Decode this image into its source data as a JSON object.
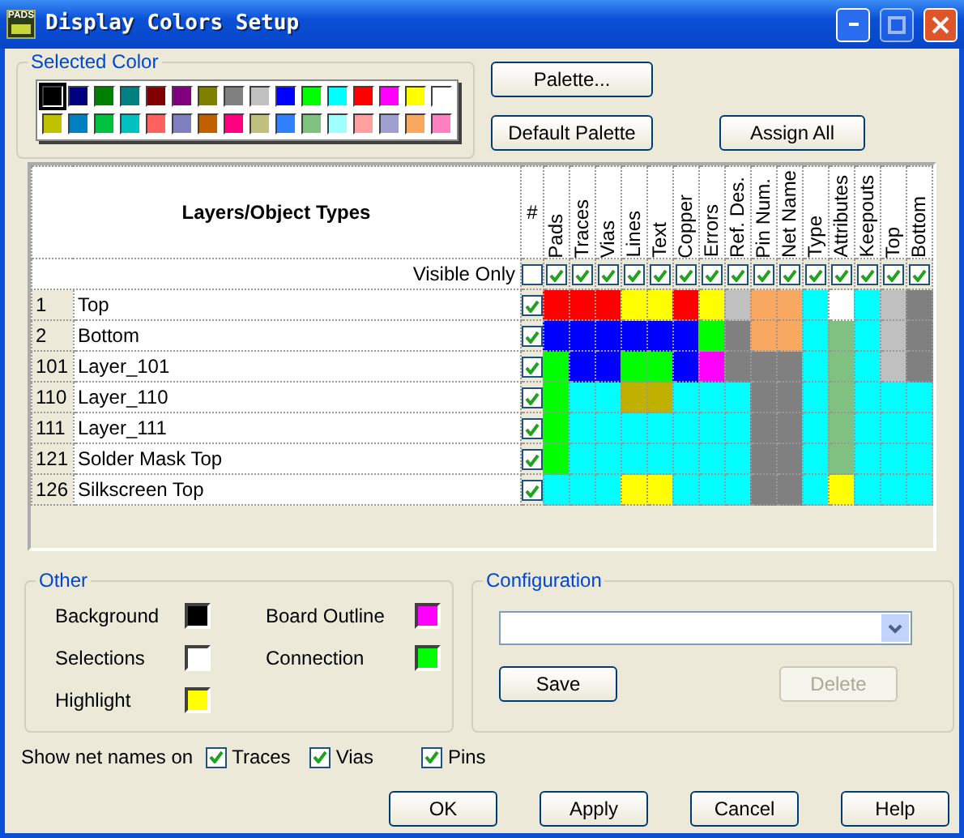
{
  "window": {
    "icon_text": "PADS",
    "title": "Display Colors Setup"
  },
  "selected_color": {
    "title": "Selected Color",
    "swatches": [
      {
        "color": "#000000",
        "selected": true
      },
      {
        "color": "#000080",
        "selected": false
      },
      {
        "color": "#008000",
        "selected": false
      },
      {
        "color": "#008080",
        "selected": false
      },
      {
        "color": "#800000",
        "selected": false
      },
      {
        "color": "#800080",
        "selected": false
      },
      {
        "color": "#808000",
        "selected": false
      },
      {
        "color": "#808080",
        "selected": false
      },
      {
        "color": "#c0c0c0",
        "selected": false
      },
      {
        "color": "#0000ff",
        "selected": false
      },
      {
        "color": "#00ff00",
        "selected": false
      },
      {
        "color": "#00ffff",
        "selected": false
      },
      {
        "color": "#ff0000",
        "selected": false
      },
      {
        "color": "#ff00ff",
        "selected": false
      },
      {
        "color": "#ffff00",
        "selected": false
      },
      {
        "color": "#ffffff",
        "selected": false
      },
      {
        "color": "#c0c000",
        "selected": false
      },
      {
        "color": "#0080c0",
        "selected": false
      },
      {
        "color": "#00c040",
        "selected": false
      },
      {
        "color": "#00c0c0",
        "selected": false
      },
      {
        "color": "#ff6060",
        "selected": false
      },
      {
        "color": "#8080c0",
        "selected": false
      },
      {
        "color": "#c06000",
        "selected": false
      },
      {
        "color": "#ff0080",
        "selected": false
      },
      {
        "color": "#c0c080",
        "selected": false
      },
      {
        "color": "#3080ff",
        "selected": false
      },
      {
        "color": "#80c080",
        "selected": false
      },
      {
        "color": "#a0ffff",
        "selected": false
      },
      {
        "color": "#ffa0a0",
        "selected": false
      },
      {
        "color": "#a0a0d0",
        "selected": false
      },
      {
        "color": "#f8a860",
        "selected": false
      },
      {
        "color": "#ff80c0",
        "selected": false
      }
    ]
  },
  "palette_buttons": [
    {
      "label": "Palette..."
    },
    {
      "label": "Default Palette"
    },
    {
      "label": "Assign All"
    }
  ],
  "grid": {
    "title": "Layers/Object Types",
    "hash_header": "#",
    "visible_only": {
      "label": "Visible Only",
      "checked": false
    },
    "columns": [
      {
        "label": "Pads",
        "visible": true
      },
      {
        "label": "Traces",
        "visible": true
      },
      {
        "label": "Vias",
        "visible": true
      },
      {
        "label": "Lines",
        "visible": true
      },
      {
        "label": "Text",
        "visible": true
      },
      {
        "label": "Copper",
        "visible": true
      },
      {
        "label": "Errors",
        "visible": true
      },
      {
        "label": "Ref. Des.",
        "visible": true
      },
      {
        "label": "Pin Num.",
        "visible": true
      },
      {
        "label": "Net Name",
        "visible": true
      },
      {
        "label": "Type",
        "visible": true
      },
      {
        "label": "Attributes",
        "visible": true
      },
      {
        "label": "Keepouts",
        "visible": true
      },
      {
        "label": "Top",
        "visible": true
      },
      {
        "label": "Bottom",
        "visible": true
      }
    ],
    "rows": [
      {
        "number": "1",
        "name": "Top",
        "visible": true,
        "cells": [
          {
            "color": "#ff0000"
          },
          {
            "color": "#ff0000"
          },
          {
            "color": "#ff0000"
          },
          {
            "color": "#ffff00"
          },
          {
            "color": "#ffff00"
          },
          {
            "color": "#ff0000"
          },
          {
            "color": "#ffff00"
          },
          {
            "color": "#c0c0c0"
          },
          {
            "color": "#f8a860"
          },
          {
            "color": "#f8a860"
          },
          {
            "color": "#00ffff"
          },
          {
            "color": "#ffffff"
          },
          {
            "color": "#00ffff"
          },
          {
            "color": "#c0c0c0"
          },
          {
            "color": "#808080"
          }
        ]
      },
      {
        "number": "2",
        "name": "Bottom",
        "visible": true,
        "cells": [
          {
            "color": "#0000ff"
          },
          {
            "color": "#0000ff"
          },
          {
            "color": "#0000ff"
          },
          {
            "color": "#0000ff"
          },
          {
            "color": "#0000ff"
          },
          {
            "color": "#0000ff"
          },
          {
            "color": "#00ff00"
          },
          {
            "color": "#808080"
          },
          {
            "color": "#f8a860"
          },
          {
            "color": "#f8a860"
          },
          {
            "color": "#00ffff"
          },
          {
            "color": "#80c080"
          },
          {
            "color": "#00ffff"
          },
          {
            "color": "#c0c0c0"
          },
          {
            "color": "#808080"
          }
        ]
      },
      {
        "number": "101",
        "name": "Layer_101",
        "visible": true,
        "cells": [
          {
            "color": "#00ff00"
          },
          {
            "color": "#0000ff"
          },
          {
            "color": "#0000ff"
          },
          {
            "color": "#00ff00"
          },
          {
            "color": "#00ff00"
          },
          {
            "color": "#0000ff"
          },
          {
            "color": "#ff00ff"
          },
          {
            "color": "#808080"
          },
          {
            "color": "#808080"
          },
          {
            "color": "#808080"
          },
          {
            "color": "#00ffff"
          },
          {
            "color": "#80c080"
          },
          {
            "color": "#00ffff"
          },
          {
            "color": "#c0c0c0"
          },
          {
            "color": "#808080"
          }
        ]
      },
      {
        "number": "110",
        "name": "Layer_110",
        "visible": true,
        "cells": [
          {
            "color": "#00ff00"
          },
          {
            "color": "#00ffff"
          },
          {
            "color": "#00ffff"
          },
          {
            "color": "#c0b000"
          },
          {
            "color": "#c0b000"
          },
          {
            "color": "#00ffff"
          },
          {
            "color": "#00ffff"
          },
          {
            "color": "#00ffff"
          },
          {
            "color": "#808080"
          },
          {
            "color": "#808080"
          },
          {
            "color": "#00ffff"
          },
          {
            "color": "#80c080"
          },
          {
            "color": "#00ffff"
          },
          {
            "color": "#00ffff"
          },
          {
            "color": "#00ffff"
          }
        ]
      },
      {
        "number": "111",
        "name": "Layer_111",
        "visible": true,
        "cells": [
          {
            "color": "#00ff00"
          },
          {
            "color": "#00ffff"
          },
          {
            "color": "#00ffff"
          },
          {
            "color": "#00ffff"
          },
          {
            "color": "#00ffff"
          },
          {
            "color": "#00ffff"
          },
          {
            "color": "#00ffff"
          },
          {
            "color": "#00ffff"
          },
          {
            "color": "#808080"
          },
          {
            "color": "#808080"
          },
          {
            "color": "#00ffff"
          },
          {
            "color": "#80c080"
          },
          {
            "color": "#00ffff"
          },
          {
            "color": "#00ffff"
          },
          {
            "color": "#00ffff"
          }
        ]
      },
      {
        "number": "121",
        "name": "Solder Mask Top",
        "visible": true,
        "cells": [
          {
            "color": "#00ff00"
          },
          {
            "color": "#00ffff"
          },
          {
            "color": "#00ffff"
          },
          {
            "color": "#00ffff"
          },
          {
            "color": "#00ffff"
          },
          {
            "color": "#00ffff"
          },
          {
            "color": "#00ffff"
          },
          {
            "color": "#00ffff"
          },
          {
            "color": "#808080"
          },
          {
            "color": "#808080"
          },
          {
            "color": "#00ffff"
          },
          {
            "color": "#80c080"
          },
          {
            "color": "#00ffff"
          },
          {
            "color": "#00ffff"
          },
          {
            "color": "#00ffff"
          }
        ]
      },
      {
        "number": "126",
        "name": "Silkscreen Top",
        "visible": true,
        "cells": [
          {
            "color": "#00ffff"
          },
          {
            "color": "#00ffff"
          },
          {
            "color": "#00ffff"
          },
          {
            "color": "#ffff00"
          },
          {
            "color": "#ffff00"
          },
          {
            "color": "#00ffff"
          },
          {
            "color": "#00ffff"
          },
          {
            "color": "#00ffff"
          },
          {
            "color": "#808080"
          },
          {
            "color": "#808080"
          },
          {
            "color": "#00ffff"
          },
          {
            "color": "#ffff00"
          },
          {
            "color": "#00ffff"
          },
          {
            "color": "#00ffff"
          },
          {
            "color": "#00ffff"
          }
        ]
      }
    ]
  },
  "other": {
    "title": "Other",
    "items": [
      {
        "label": "Background",
        "color": "#000000"
      },
      {
        "label": "Board Outline",
        "color": "#ff00ff"
      },
      {
        "label": "Selections",
        "color": "#ffffff"
      },
      {
        "label": "Connection",
        "color": "#00ff00"
      },
      {
        "label": "Highlight",
        "color": "#ffff00"
      }
    ]
  },
  "configuration": {
    "title": "Configuration",
    "buttons": [
      {
        "label": "Save",
        "disabled": false
      },
      {
        "label": "Delete",
        "disabled": true
      }
    ]
  },
  "net_names": {
    "label": "Show net names on",
    "options": [
      {
        "label": "Traces",
        "checked": true
      },
      {
        "label": "Vias",
        "checked": true
      },
      {
        "label": "Pins",
        "checked": true
      }
    ]
  },
  "buttons": [
    {
      "label": "OK"
    },
    {
      "label": "Apply"
    },
    {
      "label": "Cancel"
    },
    {
      "label": "Help"
    }
  ]
}
